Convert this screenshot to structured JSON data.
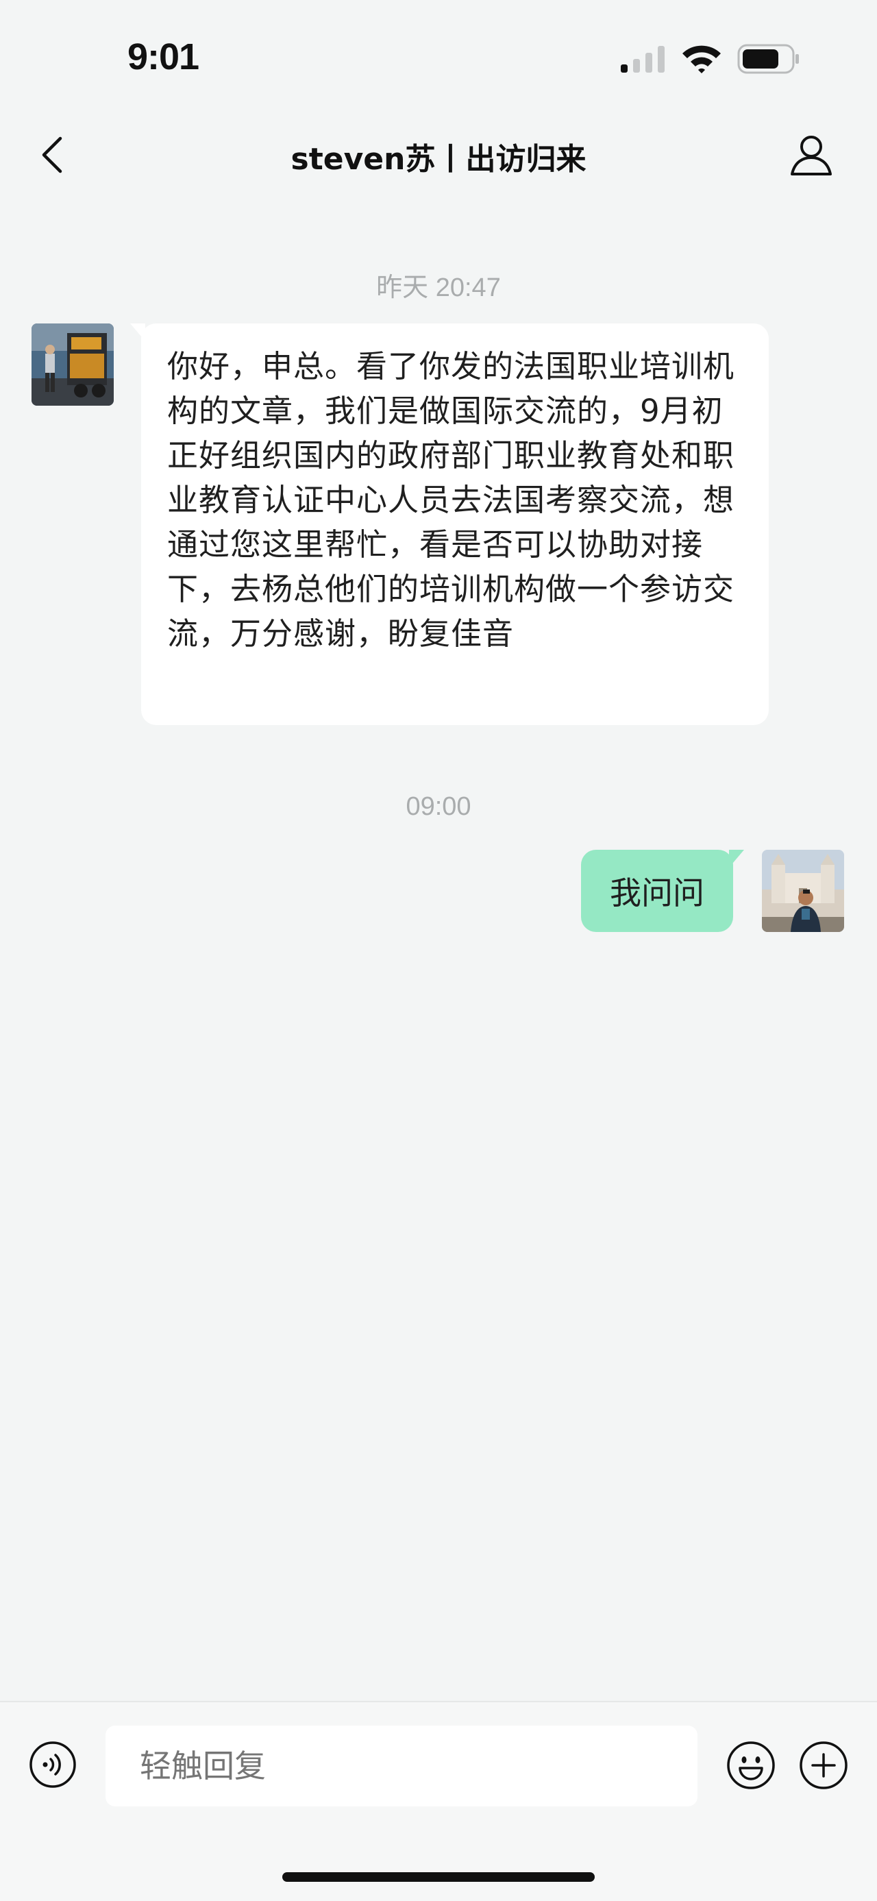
{
  "status_bar": {
    "time": "9:01",
    "icons": [
      "signal-icon",
      "wifi-icon",
      "battery-icon"
    ]
  },
  "nav": {
    "title": "steven苏丨出访归来",
    "icons": [
      "back-icon",
      "profile-icon"
    ]
  },
  "messages": [
    {
      "timestamp": "昨天 20:47",
      "direction": "incoming",
      "text": "你好，申总。看了你发的法国职业培训机构的文章，我们是做国际交流的，9月初正好组织国内的政府部门职业教育处和职业教育认证中心人员去法国考察交流，想通过您这里帮忙，看是否可以协助对接下，去杨总他们的培训机构做一个参访交流，万分感谢，盼复佳音"
    },
    {
      "timestamp": "09:00",
      "direction": "outgoing",
      "text": "我问问"
    }
  ],
  "input_bar": {
    "placeholder": "轻触回复",
    "icons": [
      "voice-icon",
      "emoji-icon",
      "plus-icon"
    ]
  },
  "colors": {
    "background": "#f3f5f5",
    "incoming_bubble": "#ffffff",
    "outgoing_bubble": "#95e8c4",
    "timestamp": "#a9acad"
  }
}
